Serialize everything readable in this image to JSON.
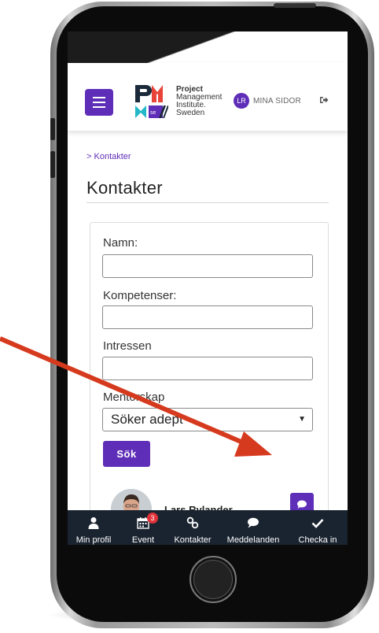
{
  "header": {
    "menu_icon": "hamburger-icon",
    "org_name_line1": "Project",
    "org_name_line2": "Management",
    "org_name_line3": "Institute.",
    "org_name_line4": "Sweden",
    "logo_mark": "se",
    "user_initials": "LR",
    "my_pages_label": "MINA SIDOR",
    "logout_icon": "sign-out-icon"
  },
  "breadcrumb": {
    "chevron": ">",
    "label": "Kontakter"
  },
  "page": {
    "title": "Kontakter"
  },
  "search_form": {
    "name_label": "Namn:",
    "name_value": "",
    "skills_label": "Kompetenser:",
    "skills_value": "",
    "interests_label": "Intressen",
    "interests_value": "",
    "mentorship_label": "Mentorskap",
    "mentorship_selected": "Söker adept",
    "search_button_label": "Sök"
  },
  "results": [
    {
      "name": "Lars Rylander",
      "action_icon": "comment-icon"
    }
  ],
  "bottom_nav": {
    "items": [
      {
        "label": "Min profil",
        "icon": "user-icon"
      },
      {
        "label": "Event",
        "icon": "calendar-icon",
        "badge": "3"
      },
      {
        "label": "Kontakter",
        "icon": "link-icon"
      },
      {
        "label": "Meddelanden",
        "icon": "comment-icon"
      },
      {
        "label": "Checka in",
        "icon": "check-icon"
      }
    ]
  },
  "colors": {
    "brand_purple": "#5f2eb8",
    "nav_background": "#1a2430",
    "annotation_arrow": "#d63a1e",
    "badge_red": "#e0323a"
  }
}
